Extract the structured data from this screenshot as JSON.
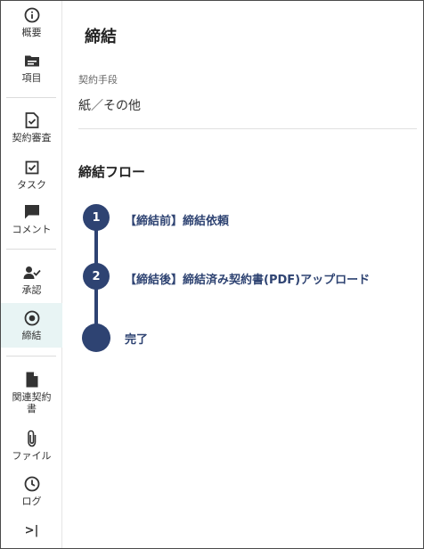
{
  "sidebar": {
    "items": [
      {
        "label": "概要",
        "icon": "info-icon"
      },
      {
        "label": "項目",
        "icon": "folder-icon"
      },
      {
        "label": "契約審査",
        "icon": "document-check-icon"
      },
      {
        "label": "タスク",
        "icon": "checkbox-icon"
      },
      {
        "label": "コメント",
        "icon": "comment-icon"
      },
      {
        "label": "承認",
        "icon": "user-check-icon"
      },
      {
        "label": "締結",
        "icon": "target-icon",
        "active": true
      },
      {
        "label": "関連契約書",
        "icon": "file-icon"
      },
      {
        "label": "ファイル",
        "icon": "paperclip-icon"
      },
      {
        "label": "ログ",
        "icon": "clock-icon"
      }
    ],
    "collapse_icon": "expand-sidebar-icon",
    "collapse_label": ">|"
  },
  "main": {
    "title": "締結",
    "method": {
      "label": "契約手段",
      "value": "紙／その他"
    },
    "flow": {
      "title": "締結フロー",
      "steps": [
        {
          "number": "1",
          "label": "【締結前】締結依頼"
        },
        {
          "number": "2",
          "label": "【締結後】締結済み契約書(PDF)アップロード"
        }
      ],
      "final_label": "完了"
    }
  },
  "colors": {
    "accent": "#2e4372",
    "active_bg": "#e8f4f4"
  }
}
